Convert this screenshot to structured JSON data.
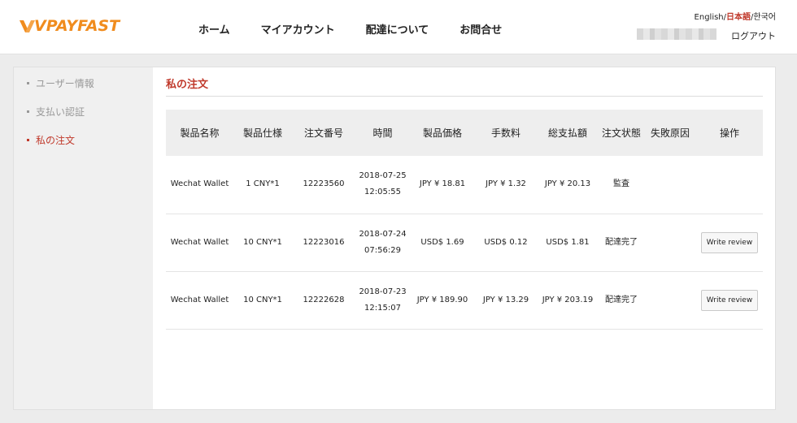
{
  "header": {
    "logo_text": "VPAYFAST",
    "nav": [
      "ホーム",
      "マイアカウント",
      "配達について",
      "お問合せ"
    ],
    "lang": {
      "english": "English",
      "japanese": "日本語",
      "korean": "한국어",
      "sep": "/"
    },
    "logout": "ログアウト"
  },
  "sidebar": {
    "items": [
      {
        "label": "ユーザー情報",
        "active": false
      },
      {
        "label": "支払い認証",
        "active": false
      },
      {
        "label": "私の注文",
        "active": true
      }
    ]
  },
  "main": {
    "title": "私の注文",
    "columns": [
      "製品名称",
      "製品仕様",
      "注文番号",
      "時間",
      "製品価格",
      "手数料",
      "総支払額",
      "注文状態",
      "失敗原因",
      "操作"
    ],
    "rows": [
      {
        "name": "Wechat Wallet",
        "spec": "1 CNY*1",
        "order": "12223560",
        "time": "2018-07-25 12:05:55",
        "price": "JPY ¥ 18.81",
        "fee": "JPY ¥ 1.32",
        "total": "JPY ¥ 20.13",
        "status": "監査",
        "fail": "",
        "action": ""
      },
      {
        "name": "Wechat Wallet",
        "spec": "10 CNY*1",
        "order": "12223016",
        "time": "2018-07-24 07:56:29",
        "price": "USD$ 1.69",
        "fee": "USD$ 0.12",
        "total": "USD$ 1.81",
        "status": "配達完了",
        "fail": "",
        "action": "Write review"
      },
      {
        "name": "Wechat Wallet",
        "spec": "10 CNY*1",
        "order": "12222628",
        "time": "2018-07-23 12:15:07",
        "price": "JPY ¥ 189.90",
        "fee": "JPY ¥ 13.29",
        "total": "JPY ¥ 203.19",
        "status": "配達完了",
        "fail": "",
        "action": "Write review"
      }
    ]
  },
  "colors": {
    "accent": "#c0392b",
    "logo": "#f08c1e"
  }
}
